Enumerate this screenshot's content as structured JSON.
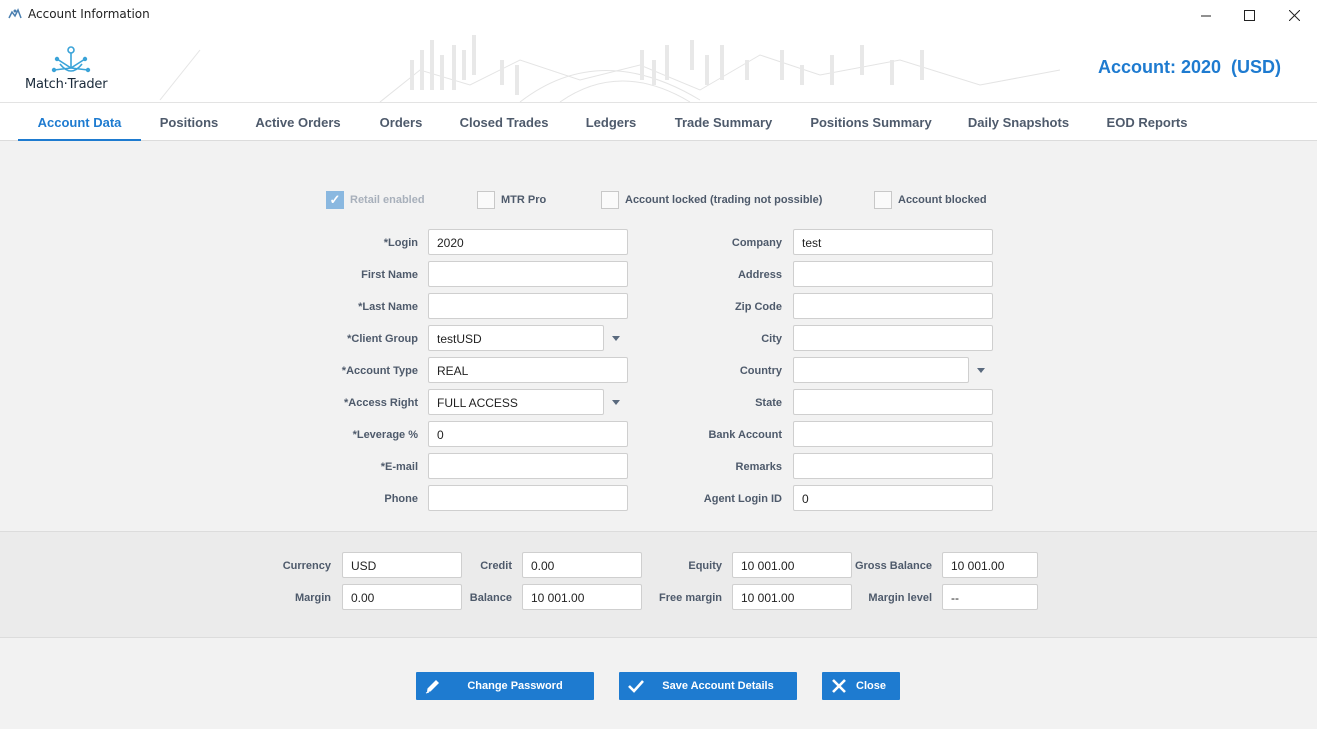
{
  "window": {
    "title": "Account Information",
    "minimize_icon": "minimize-icon",
    "maximize_icon": "maximize-icon",
    "close_icon": "close-icon"
  },
  "header": {
    "logo_text": "Match·Trader",
    "account_title": "Account: 2020  (USD)",
    "accent_color": "#1e7bd0"
  },
  "tabs": [
    {
      "label": "Account Data",
      "active": true
    },
    {
      "label": "Positions",
      "active": false
    },
    {
      "label": "Active Orders",
      "active": false
    },
    {
      "label": "Orders",
      "active": false
    },
    {
      "label": "Closed Trades",
      "active": false
    },
    {
      "label": "Ledgers",
      "active": false
    },
    {
      "label": "Trade Summary",
      "active": false
    },
    {
      "label": "Positions Summary",
      "active": false
    },
    {
      "label": "Daily Snapshots",
      "active": false
    },
    {
      "label": "EOD Reports",
      "active": false
    }
  ],
  "checkboxes": {
    "retail_enabled": {
      "label": "Retail enabled",
      "checked": true,
      "disabled": true
    },
    "mtr_pro": {
      "label": "MTR Pro",
      "checked": false
    },
    "account_locked": {
      "label": "Account locked (trading not possible)",
      "checked": false
    },
    "account_blocked": {
      "label": "Account blocked",
      "checked": false
    }
  },
  "left_fields": {
    "login": {
      "label": "*Login",
      "value": "2020"
    },
    "first_name": {
      "label": "First Name",
      "value": ""
    },
    "last_name": {
      "label": "*Last Name",
      "value": ""
    },
    "client_group": {
      "label": "*Client Group",
      "value": "testUSD"
    },
    "account_type": {
      "label": "*Account Type",
      "value": "REAL"
    },
    "access_right": {
      "label": "*Access Right",
      "value": "FULL ACCESS"
    },
    "leverage": {
      "label": "*Leverage %",
      "value": "0"
    },
    "email": {
      "label": "*E-mail",
      "value": ""
    },
    "phone": {
      "label": "Phone",
      "value": ""
    }
  },
  "right_fields": {
    "company": {
      "label": "Company",
      "value": "test"
    },
    "address": {
      "label": "Address",
      "value": ""
    },
    "zip_code": {
      "label": "Zip Code",
      "value": ""
    },
    "city": {
      "label": "City",
      "value": ""
    },
    "country": {
      "label": "Country",
      "value": ""
    },
    "state": {
      "label": "State",
      "value": ""
    },
    "bank_account": {
      "label": "Bank Account",
      "value": ""
    },
    "remarks": {
      "label": "Remarks",
      "value": ""
    },
    "agent_login_id": {
      "label": "Agent Login ID",
      "value": "0"
    }
  },
  "summary": {
    "currency": {
      "label": "Currency",
      "value": "USD"
    },
    "credit": {
      "label": "Credit",
      "value": "0.00"
    },
    "equity": {
      "label": "Equity",
      "value": "10 001.00"
    },
    "gross_balance": {
      "label": "Gross Balance",
      "value": "10 001.00"
    },
    "margin": {
      "label": "Margin",
      "value": "0.00"
    },
    "balance": {
      "label": "Balance",
      "value": "10 001.00"
    },
    "free_margin": {
      "label": "Free margin",
      "value": "10 001.00"
    },
    "margin_level": {
      "label": "Margin level",
      "value": "--"
    }
  },
  "buttons": {
    "change_password": {
      "label": "Change Password",
      "icon": "pencil-icon"
    },
    "save_account_details": {
      "label": "Save Account Details",
      "icon": "checkmark-icon"
    },
    "close": {
      "label": "Close",
      "icon": "close-icon"
    }
  }
}
